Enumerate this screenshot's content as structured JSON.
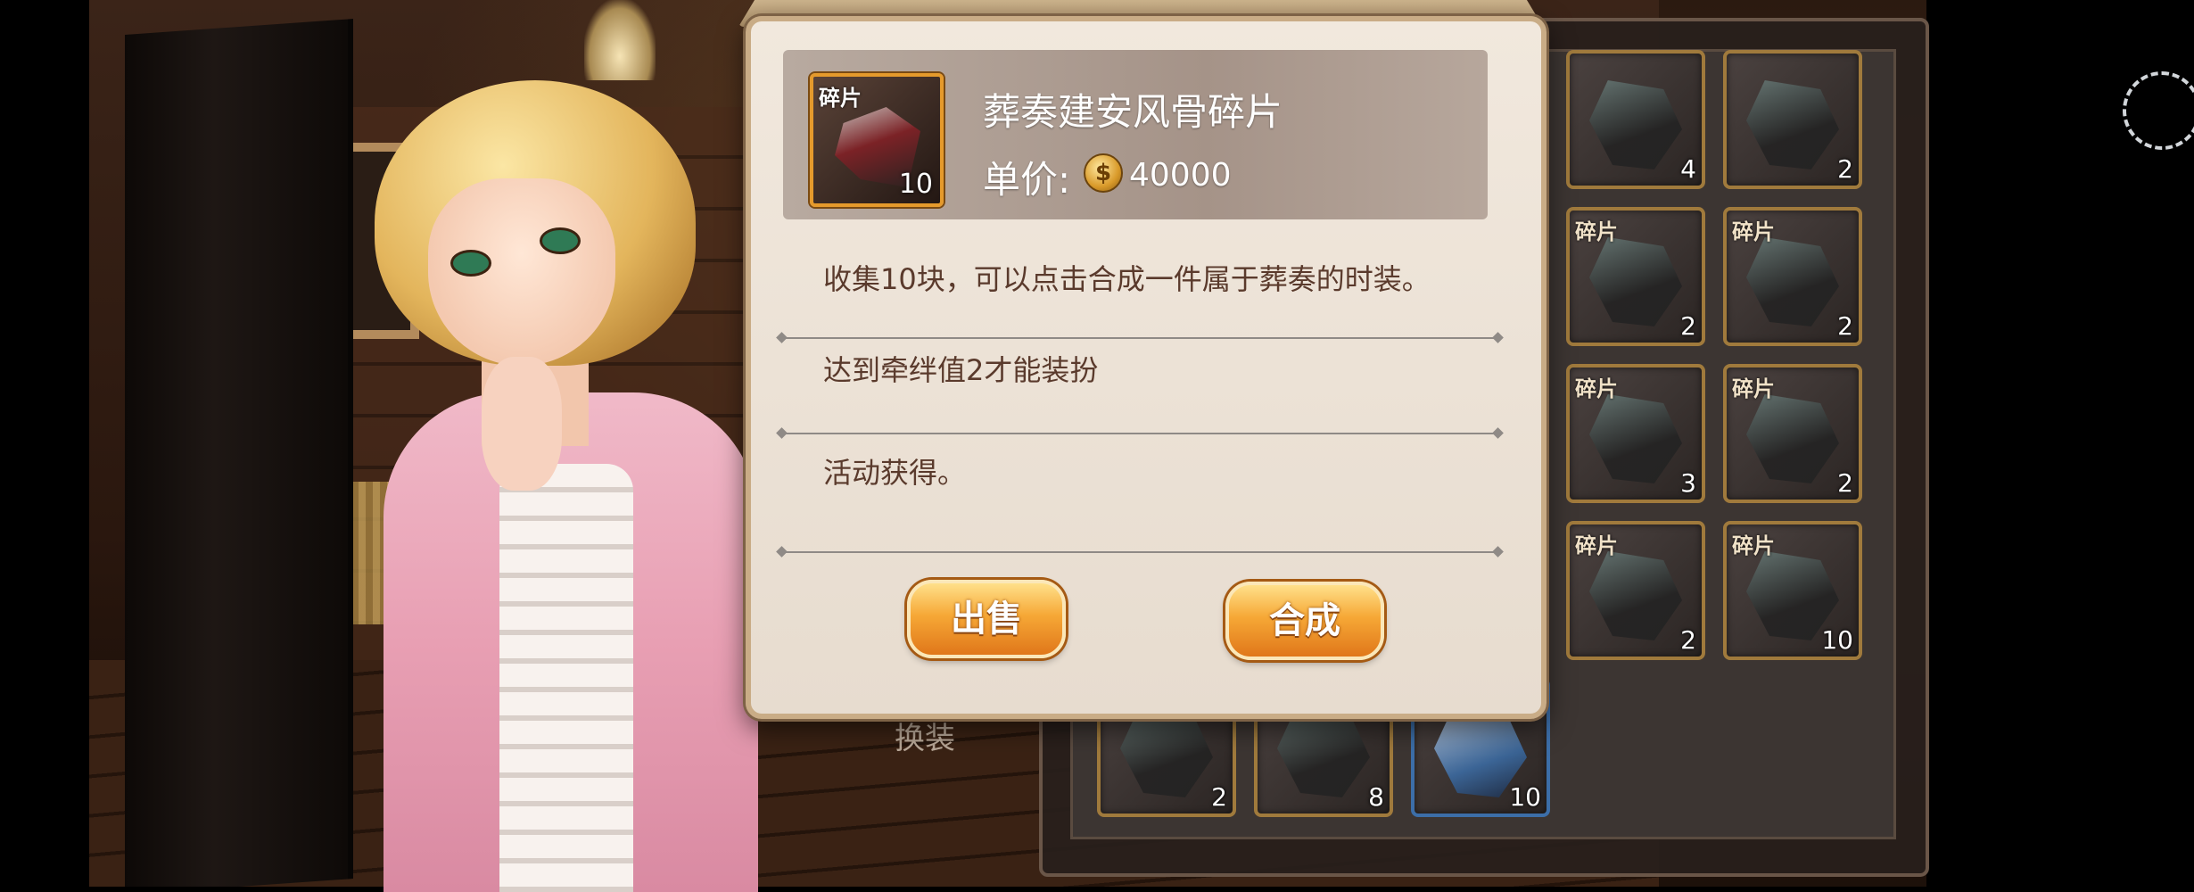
{
  "popup": {
    "item_name": "葬奏建安风骨碎片",
    "item_icon_tag": "碎片",
    "item_icon_count": "10",
    "price_label": "单价:",
    "price_value": "40000",
    "description": "收集10块，可以点击合成一件属于葬奏的时装。",
    "requirement": "达到牵绊值2才能装扮",
    "source": "活动获得。",
    "sell_button": "出售",
    "compose_button": "合成"
  },
  "background": {
    "change_outfit_label": "换装",
    "shard_tag": "碎片",
    "slots_right": [
      {
        "count": "4"
      },
      {
        "count": "2"
      },
      {
        "count": "2"
      },
      {
        "count": "2"
      },
      {
        "count": "3"
      },
      {
        "count": "2"
      },
      {
        "count": "2"
      },
      {
        "count": "10"
      }
    ],
    "slots_bottom": [
      {
        "count": "2"
      },
      {
        "count": "8"
      },
      {
        "count": "10"
      }
    ]
  },
  "colors": {
    "button_gradient_top": "#ffe08a",
    "button_gradient_bottom": "#e0771a",
    "item_frame": "#e59a2c",
    "description_text": "#5a3a2c"
  }
}
